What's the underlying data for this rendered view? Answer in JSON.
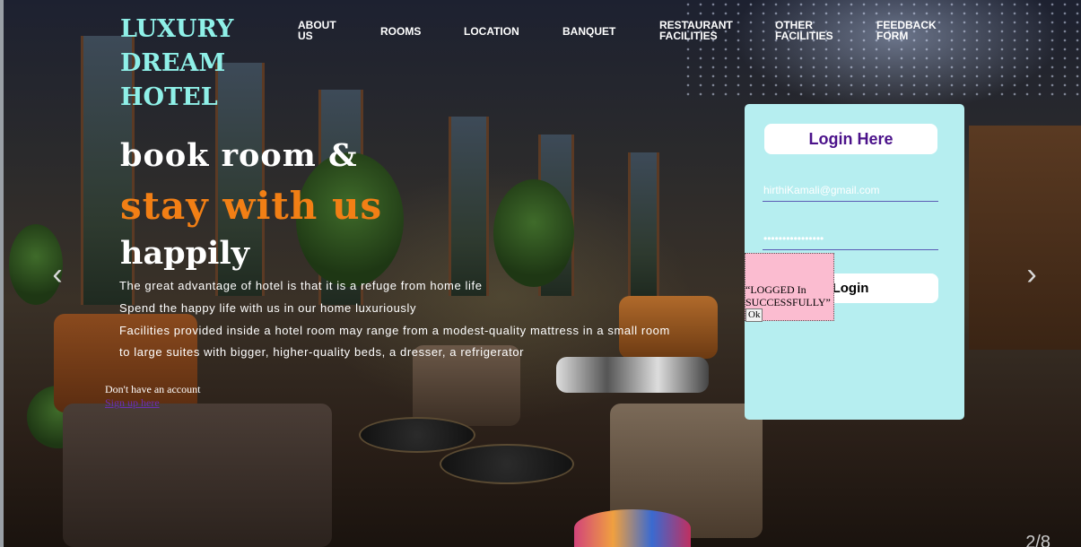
{
  "header": {
    "logo_lines": [
      "LUXURY",
      "DREAM",
      "HOTEL"
    ],
    "nav": [
      {
        "line1": "ABOUT",
        "line2": "US"
      },
      {
        "line1": "ROOMS",
        "line2": ""
      },
      {
        "line1": "LOCATION",
        "line2": ""
      },
      {
        "line1": "BANQUET",
        "line2": ""
      },
      {
        "line1": "RESTAURANT",
        "line2": "FACILITIES"
      },
      {
        "line1": "OTHER",
        "line2": "FACILITIES"
      },
      {
        "line1": "FEEDBACK",
        "line2": "FORM"
      }
    ]
  },
  "hero": {
    "headline_1": "book room &",
    "headline_2": "stay with us",
    "headline_3": "happily",
    "lines": [
      "The great advantage of hotel is that it is a refuge from home life",
      "Spend the happy life with us in our home luxuriously",
      "Facilities provided inside a hotel room may range from a modest-quality mattress in a small room",
      "to large suites with bigger, higher-quality beds, a dresser, a refrigerator"
    ],
    "signup_prompt": "Don't have an account",
    "signup_link": "Sign up here",
    "prev_arrow": "‹",
    "next_arrow": "›",
    "slide_counter": "2/8"
  },
  "login": {
    "title": "Login Here",
    "email_value": "hirthiKamali@gmail.com",
    "password_value": "••••••••••••••••",
    "button_label": "Login"
  },
  "alert": {
    "message": "“LOGGED In SUCCESSFULLY”",
    "ok_label": "Ok"
  },
  "colors": {
    "logo": "#8ff0e8",
    "accent_orange": "#f27f15",
    "login_card": "#b6eef0",
    "login_title_text": "#4b128a",
    "alert_bg": "#fbbcd0"
  }
}
